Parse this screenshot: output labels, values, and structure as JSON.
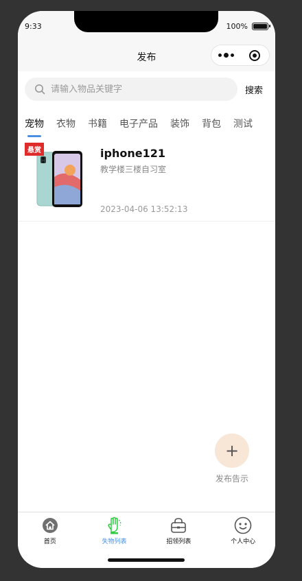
{
  "status_bar": {
    "time": "9:33",
    "battery": "100%",
    "battery_level": 1.0
  },
  "nav": {
    "title": "发布"
  },
  "search": {
    "placeholder": "请输入物品关键字",
    "button_label": "搜索"
  },
  "categories": [
    "宠物",
    "衣物",
    "书籍",
    "电子产品",
    "装饰",
    "背包",
    "测试"
  ],
  "active_category": "宠物",
  "items": [
    {
      "badge": "悬赏",
      "title": "iphone121",
      "location": "教学楼三楼自习室",
      "time": "2023-04-06 13:52:13"
    }
  ],
  "fab": {
    "icon": "+",
    "label": "发布告示"
  },
  "tab_bar": [
    {
      "label": "首页",
      "icon": "home-icon",
      "active": false
    },
    {
      "label": "失物列表",
      "icon": "hand-icon",
      "active": true
    },
    {
      "label": "招领列表",
      "icon": "bag-icon",
      "active": false
    },
    {
      "label": "个人中心",
      "icon": "face-icon",
      "active": false
    }
  ],
  "colors": {
    "accent": "#4a90e2",
    "badge": "#e02b2b",
    "fab_bg": "#f8e6d6",
    "active_icon": "#2ecc40"
  }
}
